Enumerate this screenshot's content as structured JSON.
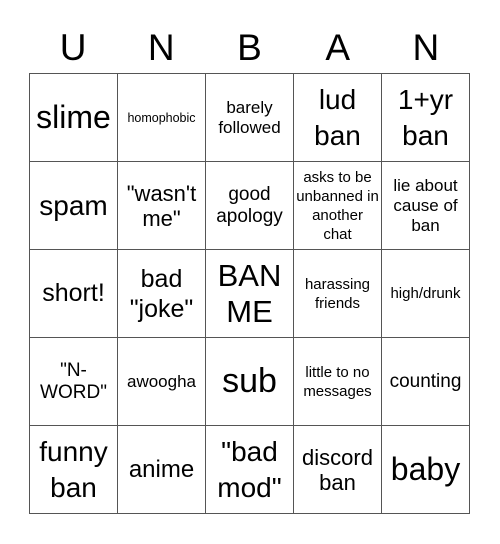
{
  "title_letters": [
    "U",
    "N",
    "B",
    "A",
    "N"
  ],
  "cells": [
    [
      "slime",
      "homophobic",
      "barely followed",
      "lud ban",
      "1+yr ban"
    ],
    [
      "spam",
      "\"wasn't me\"",
      "good apology",
      "asks to be unbanned in another chat",
      "lie about cause of ban"
    ],
    [
      "short!",
      "bad \"joke\"",
      "BAN ME",
      "harassing friends",
      "high/drunk"
    ],
    [
      "\"N-WORD\"",
      "awoogha",
      "sub",
      "little to no messages",
      "counting"
    ],
    [
      "funny ban",
      "anime",
      "\"bad mod\"",
      "discord ban",
      "baby"
    ]
  ],
  "colors": {
    "grid_line": "#555555",
    "text": "#000000",
    "background": "#ffffff"
  }
}
